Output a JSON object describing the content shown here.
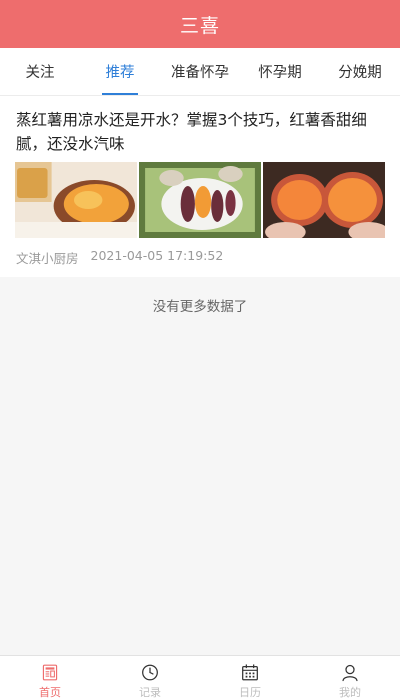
{
  "header": {
    "title": "三喜"
  },
  "tabs": [
    {
      "label": "关注",
      "active": false
    },
    {
      "label": "推荐",
      "active": true
    },
    {
      "label": "准备怀孕",
      "active": false
    },
    {
      "label": "怀孕期",
      "active": false
    },
    {
      "label": "分娩期",
      "active": false
    }
  ],
  "article": {
    "title": "蒸红薯用凉水还是开水？掌握3个技巧，红薯香甜细腻，还没水汽味",
    "author": "文淇小厨房",
    "time": "2021-04-05 17:19:52",
    "images": [
      "baked-sweet-potato-with-tea",
      "sweet-potatoes-on-plate",
      "halved-sweet-potatoes-in-hands"
    ]
  },
  "feed": {
    "end_note": "没有更多数据了"
  },
  "tabbar": {
    "items": [
      {
        "label": "首页",
        "icon": "news-icon",
        "active": true
      },
      {
        "label": "记录",
        "icon": "clock-icon",
        "active": false
      },
      {
        "label": "日历",
        "icon": "calendar-icon",
        "active": false
      },
      {
        "label": "我的",
        "icon": "person-icon",
        "active": false
      }
    ]
  },
  "colors": {
    "brand": "#ee6d6d",
    "tab_active": "#2f7fd8"
  }
}
